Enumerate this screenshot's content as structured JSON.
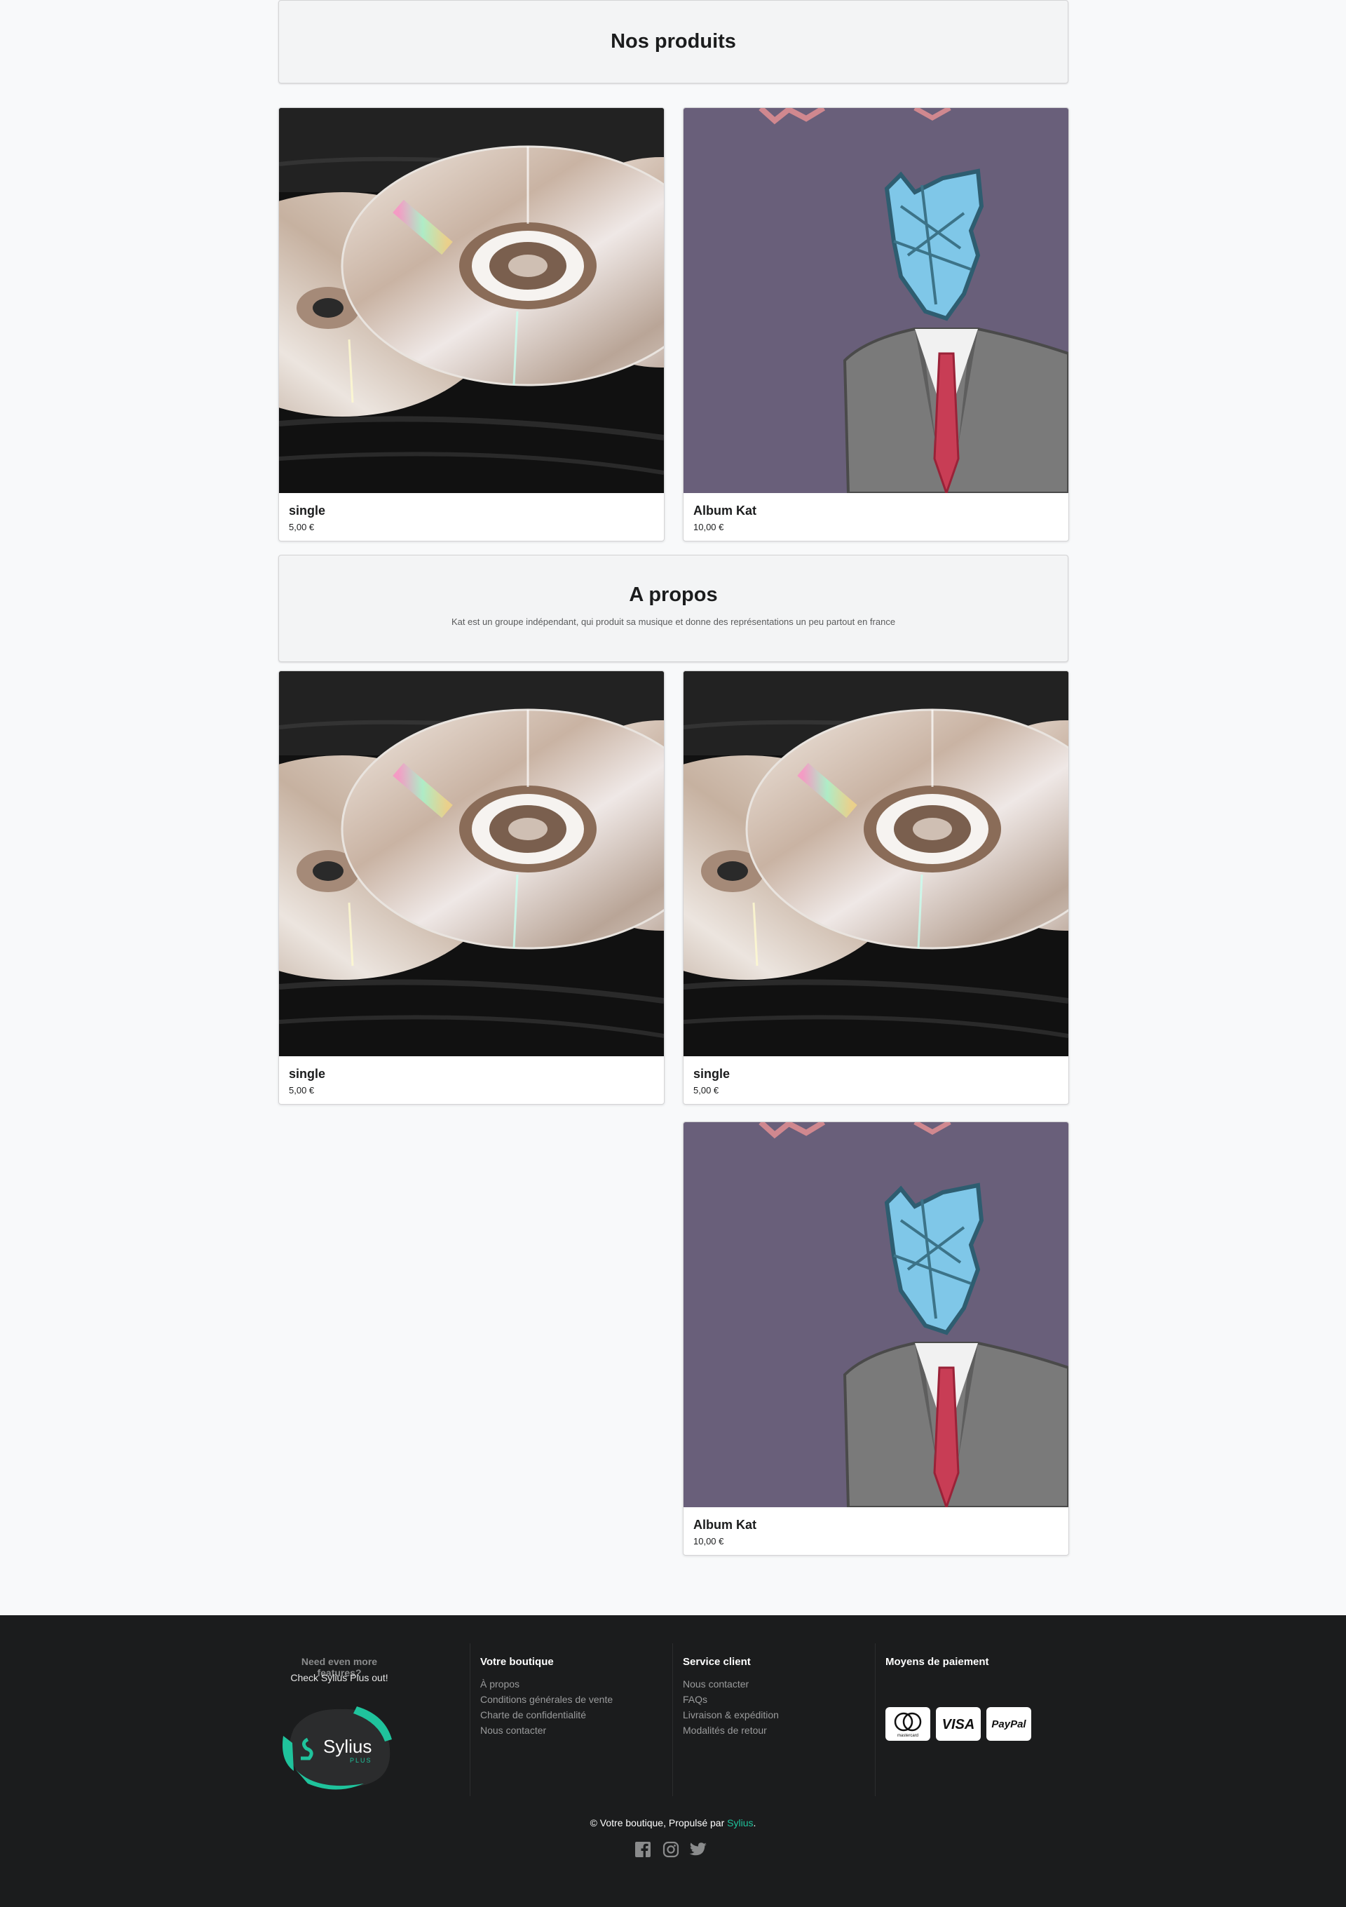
{
  "sections": {
    "products_title": "Nos produits",
    "about_title": "A propos",
    "about_text": "Kat est un groupe indépendant, qui produit sa musique et donne des représentations un peu partout en france"
  },
  "products_top": [
    {
      "name": "single",
      "price": "5,00 €",
      "image": "cd-discs"
    },
    {
      "name": "Album Kat",
      "price": "10,00 €",
      "image": "cat-in-suit"
    }
  ],
  "products_bottom": [
    {
      "name": "single",
      "price": "5,00 €",
      "image": "cd-discs"
    },
    {
      "name": "single",
      "price": "5,00 €",
      "image": "cd-discs"
    },
    {
      "name": "Album Kat",
      "price": "10,00 €",
      "image": "cat-in-suit"
    }
  ],
  "footer": {
    "plus_question": "Need even more features?",
    "plus_cta": "Check Sylius Plus out!",
    "plus_logo_text": "Sylius",
    "plus_logo_sub": "PLUS",
    "shop": {
      "title": "Votre boutique",
      "links": [
        "À propos",
        "Conditions générales de vente",
        "Charte de confidentialité",
        "Nous contacter"
      ]
    },
    "service": {
      "title": "Service client",
      "links": [
        "Nous contacter",
        "FAQs",
        "Livraison & expédition",
        "Modalités de retour"
      ]
    },
    "payment": {
      "title": "Moyens de paiement",
      "methods": [
        "mastercard",
        "VISA",
        "PayPal"
      ]
    },
    "copyright_prefix": "© Votre boutique, Propulsé par ",
    "copyright_link": "Sylius",
    "copyright_suffix": ".",
    "social_icons": [
      "facebook-icon",
      "instagram-icon",
      "twitter-icon"
    ]
  },
  "colors": {
    "accent": "#1fc39c",
    "footer_bg": "#1b1c1d",
    "page_bg": "#f8f9fa"
  }
}
